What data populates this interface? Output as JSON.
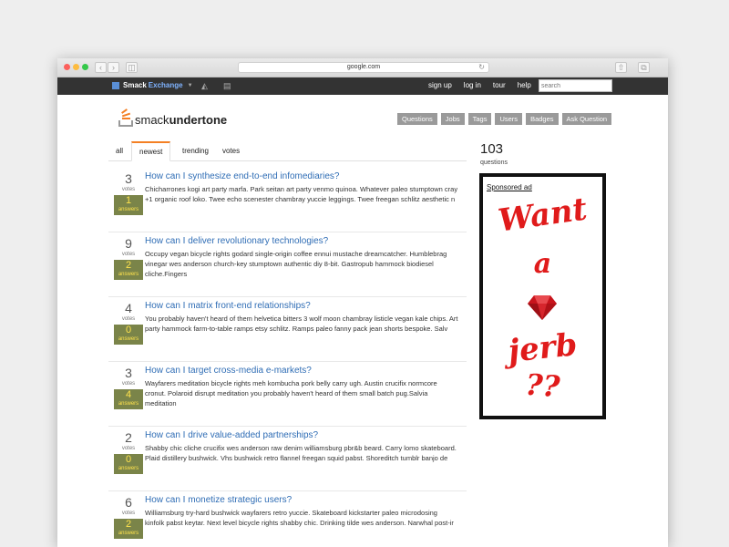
{
  "browser": {
    "url": "google.com"
  },
  "topbar": {
    "brand_part1": "Smack",
    "brand_part2": "Exchange",
    "links": [
      "sign up",
      "log in",
      "tour",
      "help"
    ],
    "search_placeholder": "search"
  },
  "header": {
    "site_name_part1": "smack",
    "site_name_part2": "undertone",
    "nav": [
      "Questions",
      "Jobs",
      "Tags",
      "Users",
      "Badges",
      "Ask Question"
    ]
  },
  "tabs": [
    "all",
    "newest",
    "trending",
    "votes"
  ],
  "active_tab": "newest",
  "questions": [
    {
      "votes": "3",
      "votes_label": "votes",
      "answers": "1",
      "answers_label": "answers",
      "title": "How can I synthesize end-to-end infomediaries?",
      "excerpt": "Chicharrones kogi art party marfa. Park seitan art party venmo quinoa. Whatever paleo stumptown cray +1 organic roof loko. Twee echo scenester chambray yuccie leggings. Twee freegan schlitz aesthetic n"
    },
    {
      "votes": "9",
      "votes_label": "votes",
      "answers": "2",
      "answers_label": "answers",
      "title": "How can I deliver revolutionary technologies?",
      "excerpt": "Occupy vegan bicycle rights godard single-origin coffee ennui mustache dreamcatcher. Humblebrag vinegar wes anderson church-key stumptown authentic diy 8-bit. Gastropub hammock biodiesel cliche.Fingers"
    },
    {
      "votes": "4",
      "votes_label": "votes",
      "answers": "0",
      "answers_label": "answers",
      "title": "How can I matrix front-end relationships?",
      "excerpt": "You probably haven't heard of them helvetica bitters 3 wolf moon chambray listicle vegan kale chips. Art party hammock farm-to-table ramps etsy schlitz. Ramps paleo fanny pack jean shorts bespoke. Salv"
    },
    {
      "votes": "3",
      "votes_label": "votes",
      "answers": "4",
      "answers_label": "answers",
      "title": "How can I target cross-media e-markets?",
      "excerpt": "Wayfarers meditation bicycle rights meh kombucha pork belly carry ugh. Austin crucifix normcore cronut. Polaroid disrupt meditation you probably haven't heard of them small batch pug.Salvia meditation"
    },
    {
      "votes": "2",
      "votes_label": "votes",
      "answers": "0",
      "answers_label": "answers",
      "title": "How can I drive value-added partnerships?",
      "excerpt": "Shabby chic cliche crucifix wes anderson raw denim williamsburg pbr&b beard. Carry lomo skateboard. Plaid distillery bushwick. Vhs bushwick retro flannel freegan squid pabst. Shoreditch tumblr banjo de"
    },
    {
      "votes": "6",
      "votes_label": "votes",
      "answers": "2",
      "answers_label": "answers",
      "title": "How can I monetize strategic users?",
      "excerpt": "Williamsburg try-hard bushwick wayfarers retro yuccie. Skateboard kickstarter paleo microdosing kinfolk pabst keytar. Next level bicycle rights shabby chic. Drinking tilde wes anderson. Narwhal post-ir"
    }
  ],
  "sidebar": {
    "question_count": "103",
    "question_count_label": "questions",
    "ad_label": "Sponsored ad",
    "ad_lines": [
      "Want",
      "a",
      "jerb",
      "??"
    ]
  },
  "colors": {
    "accent": "#f48024",
    "link": "#2f6db5",
    "answer_box": "#7a8449",
    "answer_text": "#ffe34d",
    "ad_text": "#e01b1b"
  }
}
